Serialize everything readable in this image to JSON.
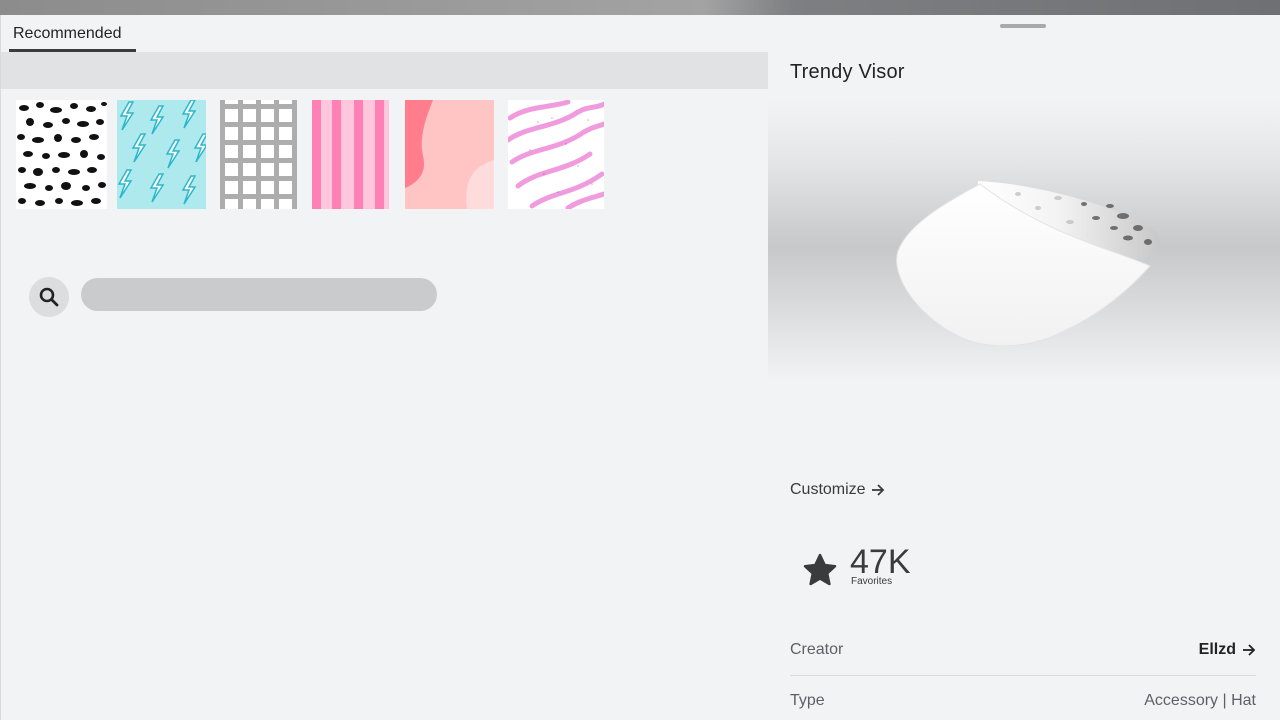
{
  "tabs": {
    "recommended_label": "Recommended"
  },
  "swatches": [
    {
      "name": "leopard-print",
      "colors": [
        "#ffffff",
        "#111111"
      ]
    },
    {
      "name": "lightning-bolts",
      "colors": [
        "#aee9ee",
        "#2bb7cc"
      ]
    },
    {
      "name": "gingham",
      "colors": [
        "#ffffff",
        "#6b6b6b"
      ]
    },
    {
      "name": "pink-stripes",
      "colors": [
        "#ffb8d4",
        "#ff80b4"
      ]
    },
    {
      "name": "pink-waves",
      "colors": [
        "#ffc4c4",
        "#ff7d8c"
      ]
    },
    {
      "name": "zebra-pink",
      "colors": [
        "#ffffff",
        "#f19bdf"
      ]
    }
  ],
  "search": {
    "placeholder": "",
    "value": ""
  },
  "item": {
    "title": "Trendy Visor",
    "customize_label": "Customize",
    "favorites_count": "47K",
    "favorites_label": "Favorites",
    "creator_label": "Creator",
    "creator_name": "Ellzd",
    "type_label": "Type",
    "type_value": "Accessory | Hat"
  },
  "icons": {
    "search": "search-icon",
    "arrow": "arrow-right-icon",
    "star": "star-icon"
  }
}
